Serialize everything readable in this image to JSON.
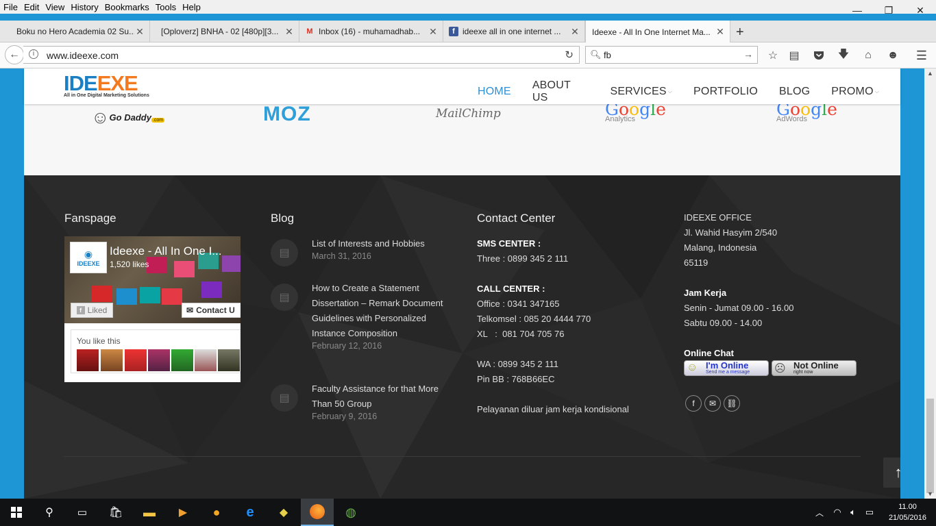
{
  "menubar": {
    "items": [
      "File",
      "Edit",
      "View",
      "History",
      "Bookmarks",
      "Tools",
      "Help"
    ]
  },
  "window_controls": {
    "minimize": "—",
    "maximize": "❐",
    "close": "✕"
  },
  "tabs": [
    {
      "label": "Boku no Hero Academia 02 Su...",
      "icon": "none"
    },
    {
      "label": "[Oploverz] BNHA - 02 [480p][3...",
      "icon": "none"
    },
    {
      "label": "Inbox (16) - muhamadhab...",
      "icon": "gmail-icon"
    },
    {
      "label": "ideexe all in one internet ...",
      "icon": "facebook-icon"
    },
    {
      "label": "Ideexe - All In One Internet Ma...",
      "icon": "none",
      "active": true
    }
  ],
  "new_tab": "+",
  "urlbar": {
    "url": "www.ideexe.com"
  },
  "searchbar": {
    "value": "fb"
  },
  "site": {
    "logo": {
      "part1": "IDE",
      "part2": "EXE",
      "tagline": "All in One Digital Marketing Solutions"
    },
    "nav": [
      {
        "label": "HOME",
        "active": true,
        "dropdown": false
      },
      {
        "label": "ABOUT US",
        "active": false,
        "dropdown": false
      },
      {
        "label": "SERVICES",
        "active": false,
        "dropdown": true
      },
      {
        "label": "PORTFOLIO",
        "active": false,
        "dropdown": false
      },
      {
        "label": "BLOG",
        "active": false,
        "dropdown": false
      },
      {
        "label": "PROMO",
        "active": false,
        "dropdown": true
      }
    ],
    "partners": {
      "godaddy": "Go Daddy",
      "godaddy_suffix": ".com",
      "moz": "MOZ",
      "mailchimp": "MailChimp",
      "google_analytics": {
        "word": "Google",
        "sub": "Analytics"
      },
      "google_adwords": {
        "word": "Google",
        "sub": "AdWords"
      }
    }
  },
  "footer": {
    "fanspage": {
      "heading": "Fanspage",
      "page_name": "Ideexe - All In One I...",
      "likes": "1,520 likes",
      "liked_label": "Liked",
      "contact_label": "Contact U",
      "you_like": "You like this",
      "avatar_label": "IDEEXE"
    },
    "blog": {
      "heading": "Blog",
      "posts": [
        {
          "title": "List of Interests and Hobbies",
          "date": "March 31, 2016"
        },
        {
          "title": "How to Create a Statement Dissertation – Remark Document Guidelines with Personalized Instance Composition",
          "date": "February 12, 2016"
        },
        {
          "title": "Faculty Assistance for that More Than 50 Group",
          "date": "February 9, 2016"
        }
      ]
    },
    "contact": {
      "heading": "Contact Center",
      "sms_title": "SMS CENTER :",
      "sms_line": "Three : 0899 345 2 111",
      "call_title": "CALL CENTER :",
      "call_lines": [
        "Office : 0341 347165",
        "Telkomsel : 085 20 4444 770",
        "XL   :  081 704 705 76"
      ],
      "wa": "WA : 0899 345 2 111",
      "pinbb": "Pin BB : 768B66EC",
      "note": "Pelayanan diluar jam kerja kondisional"
    },
    "office": {
      "title": "IDEEXE OFFICE",
      "address": [
        "Jl. Wahid Hasyim 2/540",
        "Malang, Indonesia",
        "65119"
      ],
      "hours_title": "Jam Kerja",
      "hours": [
        "Senin - Jumat 09.00 - 16.00",
        "Sabtu 09.00 - 14.00"
      ],
      "chat_title": "Online Chat",
      "online_badge": {
        "big": "I'm Online",
        "small": "Send me a message"
      },
      "offline_badge": {
        "big": "Not Online",
        "small": "right now"
      }
    },
    "to_top": "↑"
  },
  "taskbar": {
    "time": "11.00",
    "date": "21/05/2016"
  },
  "colors": {
    "accent": "#2d8fd5",
    "logo_blue": "#1b7fc3",
    "logo_orange": "#f47a20",
    "footer_bg": "#272727",
    "page_bg": "#1e95d4"
  }
}
